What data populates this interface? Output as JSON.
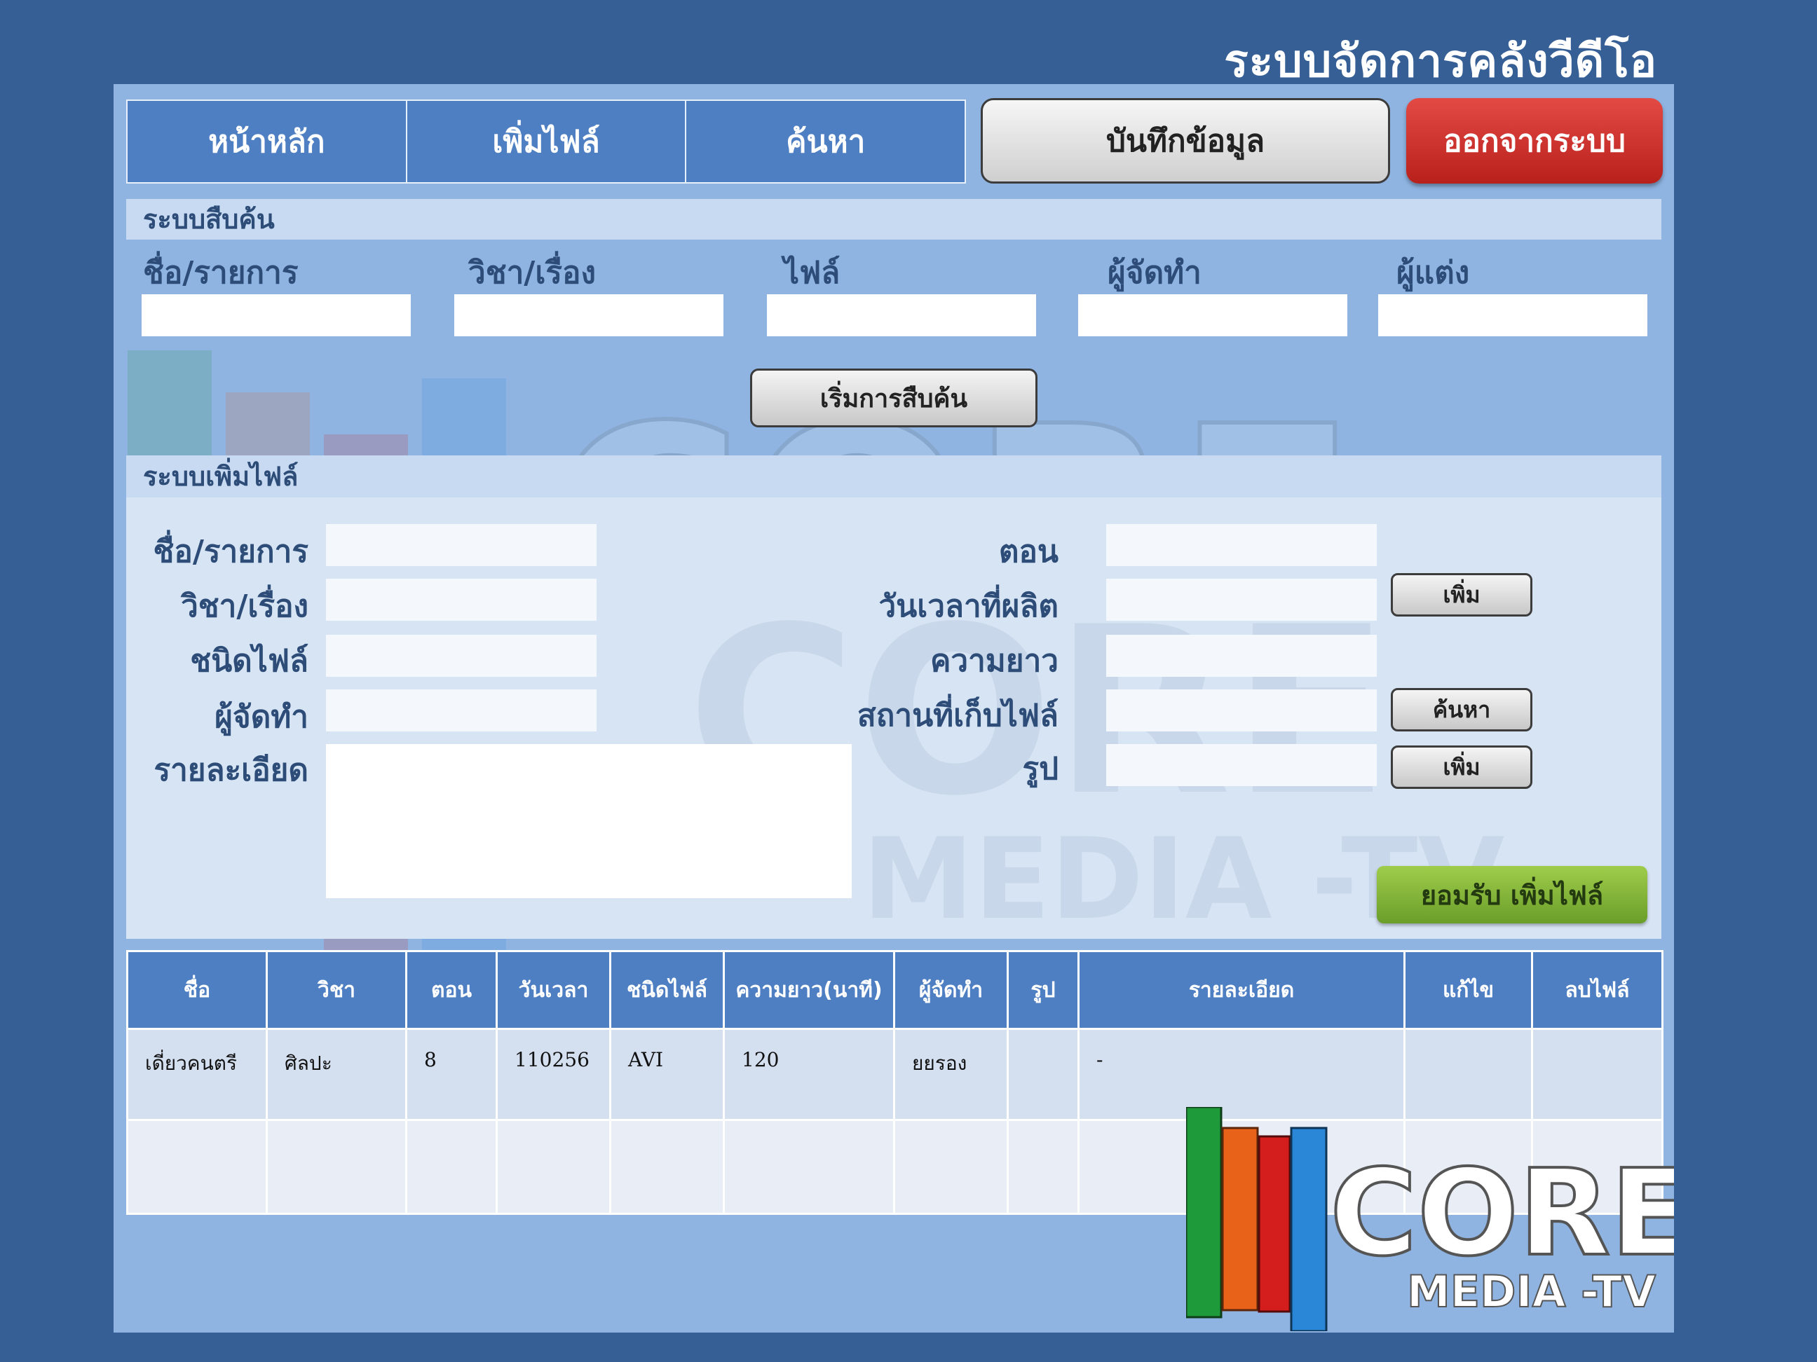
{
  "app_title": "ระบบจัดการคลังวีดีโอ",
  "nav": {
    "tabs": [
      "หน้าหลัก",
      "เพิ่มไฟล์",
      "ค้นหา"
    ],
    "save_label": "บันทึกข้อมูล",
    "logout_label": "ออกจากระบบ"
  },
  "search": {
    "section_title": "ระบบสืบค้น",
    "fields": [
      "ชื่อ/รายการ",
      "วิชา/เรื่อง",
      "ไฟล์",
      "ผู้จัดทำ",
      "ผู้แต่ง"
    ],
    "button_label": "เริ่มการสืบค้น"
  },
  "add": {
    "section_title": "ระบบเพิ่มไฟล์",
    "left_fields": [
      "ชื่อ/รายการ",
      "วิชา/เรื่อง",
      "ชนิดไฟล์",
      "ผู้จัดทำ",
      "รายละเอียด"
    ],
    "right_fields": [
      "ตอน",
      "วันเวลาที่ผลิต",
      "ความยาว",
      "สถานที่เก็บไฟล์",
      "รูป"
    ],
    "btn_add_date": "เพิ่ม",
    "btn_browse": "ค้นหา",
    "btn_add_image": "เพิ่ม",
    "accept_label": "ยอมรับ เพิ่มไฟล์"
  },
  "table": {
    "headers": [
      "ชื่อ",
      "วิชา",
      "ตอน",
      "วันเวลา",
      "ชนิดไฟล์",
      "ความยาว(นาที)",
      "ผู้จัดทำ",
      "รูป",
      "รายละเอียด",
      "แก้ไข",
      "ลบไฟล์"
    ],
    "rows": [
      [
        "เดี่ยวคนตรี",
        "ศิลปะ",
        "8",
        "110256",
        "AVI",
        "120",
        "ยยรอง",
        "",
        "-",
        "",
        ""
      ]
    ]
  },
  "logo": {
    "text_main": "CORE",
    "text_sub": "MEDIA -TV",
    "bar_colors": [
      "#1f9a3a",
      "#e8621a",
      "#d41e1e",
      "#2a86d6"
    ]
  }
}
